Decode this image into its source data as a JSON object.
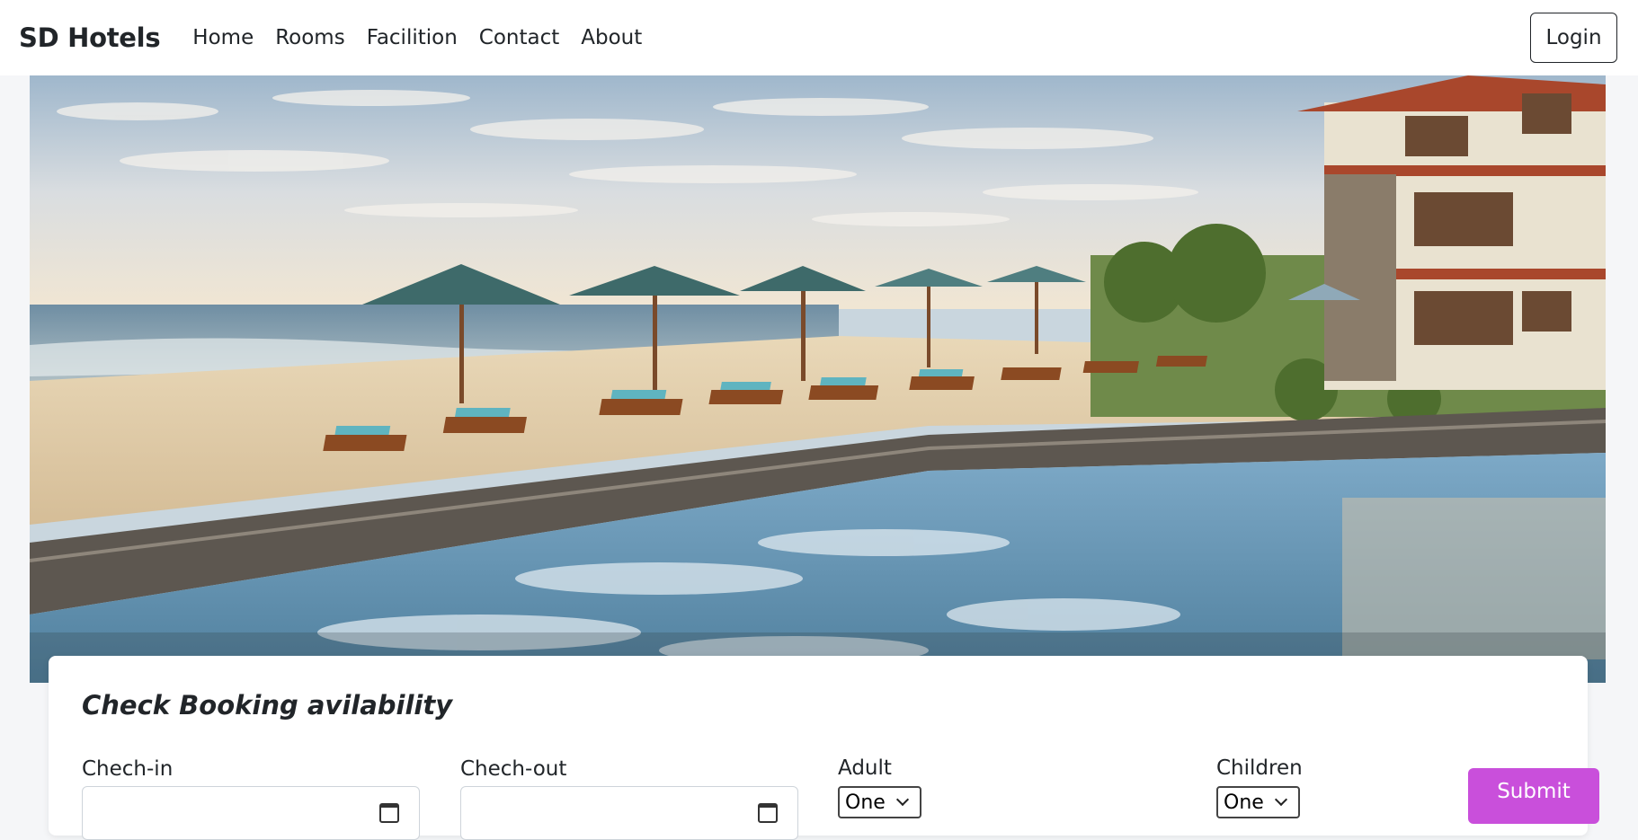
{
  "navbar": {
    "brand": "SD Hotels",
    "links": [
      "Home",
      "Rooms",
      "Facilition",
      "Contact",
      "About"
    ],
    "login_label": "Login"
  },
  "hero": {
    "image_subject": "beach-resort-with-umbrellas-loungers-and-infinity-pool"
  },
  "booking": {
    "title": "Check Booking avilability",
    "checkin_label": "Chech-in",
    "checkout_label": "Chech-out",
    "adult_label": "Adult",
    "adult_value": "One",
    "children_label": "Children",
    "children_value": "One",
    "submit_label": "Submit"
  },
  "colors": {
    "submit_bg": "#c94fdb",
    "navbar_bg": "#ffffff",
    "page_bg": "#f5f6f8"
  }
}
